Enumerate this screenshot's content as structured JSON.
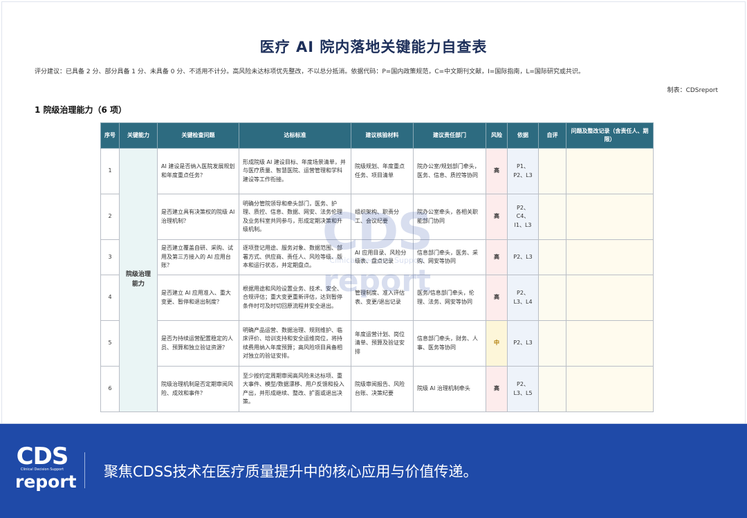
{
  "doc": {
    "title": "医疗 AI 院内落地关键能力自查表",
    "scoring_note": "评分建议：已具备 2 分、部分具备 1 分、未具备 0 分、不适用不计分。高风险未达标项优先整改，不以总分抵消。依据代码：P=国内政策规范，C=中文期刊文献，I=国际指南，L=国际研究或共识。",
    "author": "制表：CDSreport",
    "section_title": "1 院级治理能力（6 项）"
  },
  "table": {
    "headers": [
      "序号",
      "关键能力",
      "关键检查问题",
      "达标标准",
      "建议核验材料",
      "建议责任部门",
      "风险",
      "依据",
      "自评",
      "问题及整改记录（含责任人、期限）"
    ],
    "capability": "院级治理能力",
    "rows": [
      {
        "no": "1",
        "question": "AI 建设是否纳入医院发展规划和年度重点任务？",
        "standard": "形成院级 AI 建设目标、年度场景清单，并与医疗质量、智慧医院、运营管理和学科建设等工作衔接。",
        "materials": "院级规划、年度重点任务、项目清单",
        "department": "院办公室/规划部门牵头，医务、信息、质控等协同",
        "risk": "高",
        "basis": "P1、P2、L3"
      },
      {
        "no": "2",
        "question": "是否建立具有决策权的院级 AI 治理机制？",
        "standard": "明确分管院领导和牵头部门，医务、护理、质控、信息、数据、网安、法务伦理及业务科室共同参与，形成定期决策和升级机制。",
        "materials": "组织架构、职责分工、会议纪要",
        "department": "院办公室牵头，各相关职能部门协同",
        "risk": "高",
        "basis": "P2、C4、I1、L3"
      },
      {
        "no": "3",
        "question": "是否建立覆盖自研、采购、试用及第三方接入的 AI 应用台账？",
        "standard": "逐项登记用途、服务对象、数据范围、部署方式、供应商、责任人、风险等级、版本和运行状态，并定期盘点。",
        "materials": "AI 应用目录、风险分级表、盘点记录",
        "department": "信息部门牵头，医务、采购、网安等协同",
        "risk": "高",
        "basis": "P2、L3"
      },
      {
        "no": "4",
        "question": "是否建立 AI 应用准入、重大变更、暂停和退出制度？",
        "standard": "根据用途和风险设置业务、技术、安全、合规评估；重大变更重新评估，达到暂停条件时可及时切回原流程并安全退出。",
        "materials": "管理制度、准入评估表、变更/退出记录",
        "department": "医务/信息部门牵头，伦理、法务、网安等协同",
        "risk": "高",
        "basis": "P2、L3、L4"
      },
      {
        "no": "5",
        "question": "是否为持续运营配置稳定的人员、预算和独立验证资源？",
        "standard": "明确产品运营、数据治理、规则维护、临床评价、培训支持和安全运维岗位，将持续费用纳入年度预算；高风险项目具备相对独立的验证安排。",
        "materials": "年度运营计划、岗位清单、预算及验证安排",
        "department": "信息部门牵头，财务、人事、医务等协同",
        "risk": "中",
        "basis": "P2、L3"
      },
      {
        "no": "6",
        "question": "院级治理机制是否定期审阅风险、成效和事件？",
        "standard": "至少按约定周期审阅高风险未达标项、重大事件、模型/数据漂移、用户反馈和投入产出，并形成继续、整改、扩面或退出决策。",
        "materials": "院级审阅报告、风险台账、决策纪要",
        "department": "院级 AI 治理机制牵头",
        "risk": "高",
        "basis": "P2、L3、L5"
      }
    ]
  },
  "watermark": {
    "logo": "CDS",
    "sub": "Clinical Decision Support",
    "word": "report"
  },
  "footer": {
    "logo_main": "CDS",
    "logo_sub": "Clinical Decision Support",
    "logo_word": "report",
    "tagline": "聚焦CDSS技术在医疗质量提升中的核心应用与价值传递。"
  },
  "colors": {
    "header_bg": "#2d6b80",
    "footer_bg": "#1f4aa8",
    "risk_high": "#c0392b",
    "risk_mid": "#b07a00"
  }
}
